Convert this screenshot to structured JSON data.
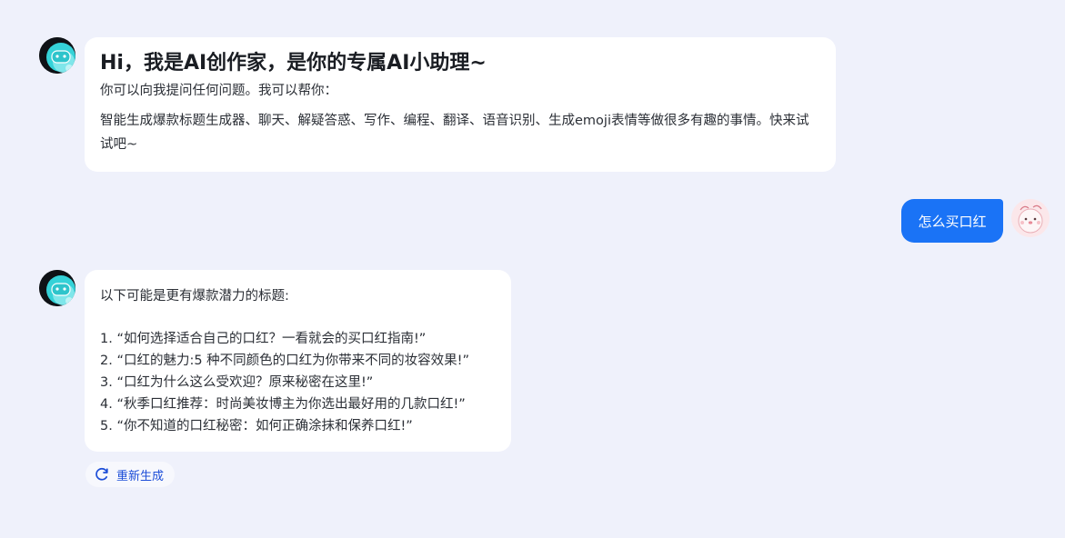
{
  "welcome": {
    "title": "Hi，我是AI创作家，是你的专属AI小助理~",
    "subtitle": "你可以向我提问任何问题。我可以帮你：",
    "capabilities": "智能生成爆款标题生成器、聊天、解疑答惑、写作、编程、翻译、语音识别、生成emoji表情等做很多有趣的事情。快来试试吧~"
  },
  "user_message": {
    "text": "怎么买口红"
  },
  "answer": {
    "intro": "以下可能是更有爆款潜力的标题:",
    "items": [
      "1. “如何选择适合自己的口红？一看就会的买口红指南!”",
      "2. “口红的魅力:5 种不同颜色的口红为你带来不同的妆容效果!”",
      "3. “口红为什么这么受欢迎？原来秘密在这里!”",
      "4. “秋季口红推荐：时尚美妆博主为你选出最好用的几款口红!”",
      "5. “你不知道的口红秘密：如何正确涂抹和保养口红!”"
    ]
  },
  "actions": {
    "regenerate_label": "重新生成",
    "regenerate_icon": "refresh-icon"
  },
  "colors": {
    "background": "#eff1fb",
    "user_bubble": "#1a73f6",
    "bot_bubble": "#ffffff",
    "accent": "#1d4ed8"
  }
}
